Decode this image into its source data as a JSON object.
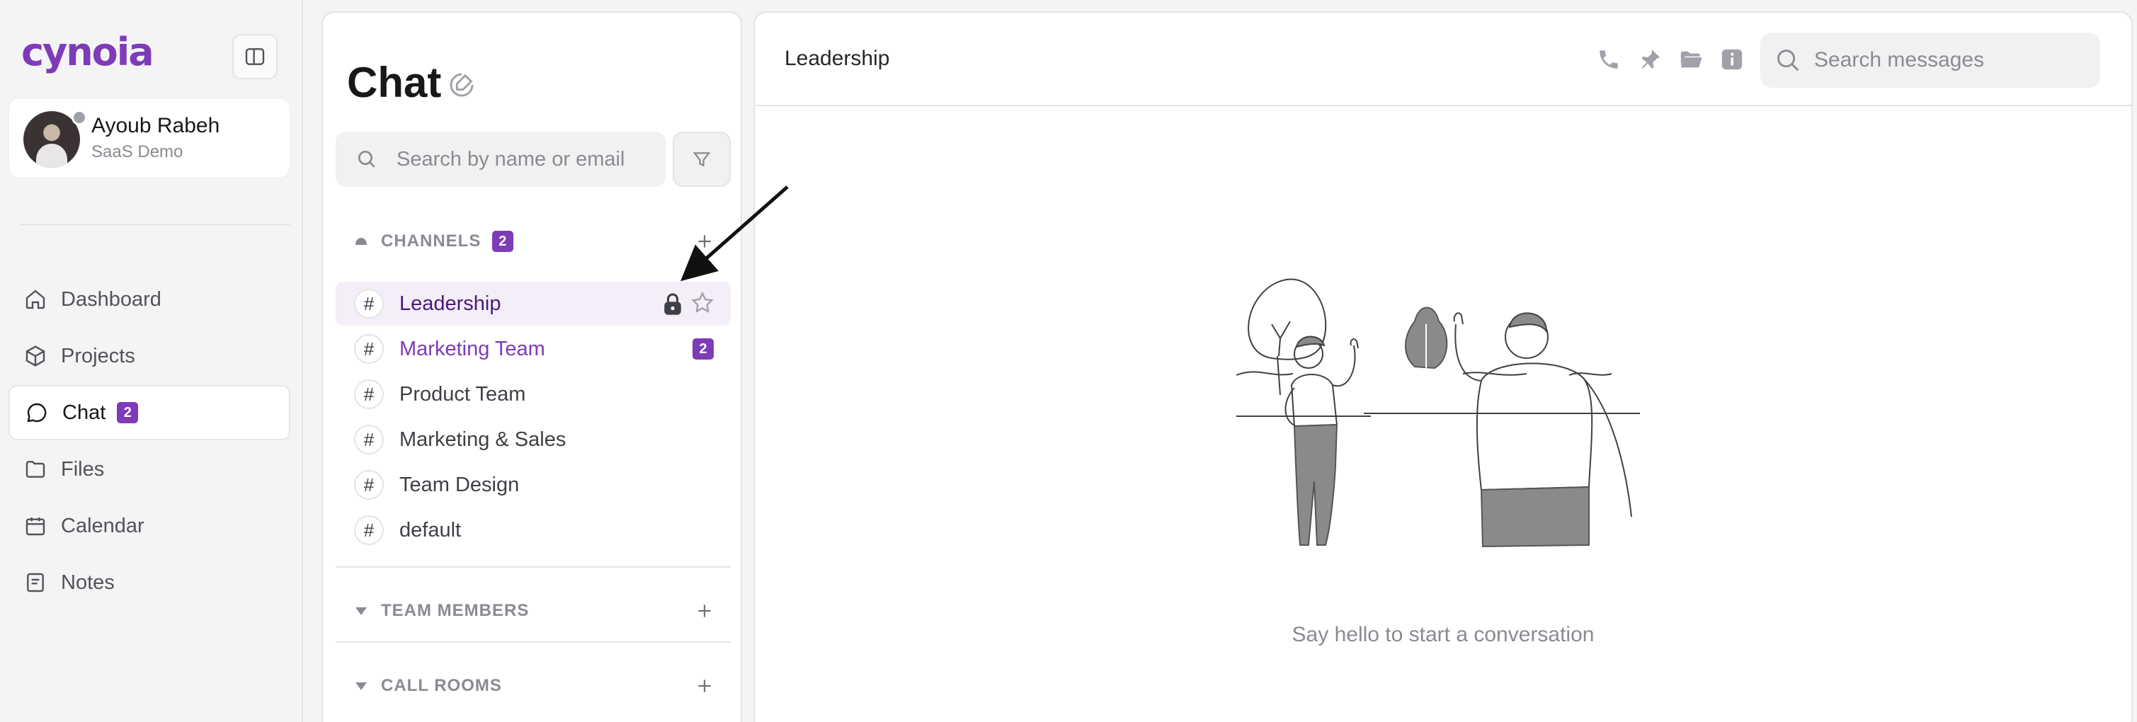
{
  "app": {
    "logo_text": "cynoia",
    "brand_color": "#7e3bb8"
  },
  "user": {
    "name": "Ayoub Rabeh",
    "org": "SaaS Demo",
    "presence": "offline"
  },
  "nav": {
    "items": [
      {
        "label": "Dashboard",
        "icon": "dashboard-icon"
      },
      {
        "label": "Projects",
        "icon": "box-icon"
      },
      {
        "label": "Chat",
        "icon": "chat-icon",
        "badge": "2",
        "active": true
      },
      {
        "label": "Files",
        "icon": "folder-icon"
      },
      {
        "label": "Calendar",
        "icon": "calendar-icon"
      },
      {
        "label": "Notes",
        "icon": "notes-icon"
      }
    ]
  },
  "chat_panel": {
    "title": "Chat",
    "search_placeholder": "Search by name or email",
    "channels_header": "CHANNELS",
    "channels_badge": "2",
    "team_members_header": "TEAM MEMBERS",
    "call_rooms_header": "CALL ROOMS",
    "channels": [
      {
        "name": "Leadership",
        "active": true,
        "locked": true
      },
      {
        "name": "Marketing Team",
        "unread": "2"
      },
      {
        "name": "Product Team"
      },
      {
        "name": "Marketing & Sales"
      },
      {
        "name": "Team Design"
      },
      {
        "name": "default"
      }
    ],
    "hash_symbol": "#"
  },
  "conversation": {
    "title": "Leadership",
    "search_placeholder": "Search messages",
    "header_icons": [
      "phone-icon",
      "pin-icon",
      "folder-open-icon",
      "info-icon"
    ],
    "empty_text": "Say hello to start a conversation"
  }
}
